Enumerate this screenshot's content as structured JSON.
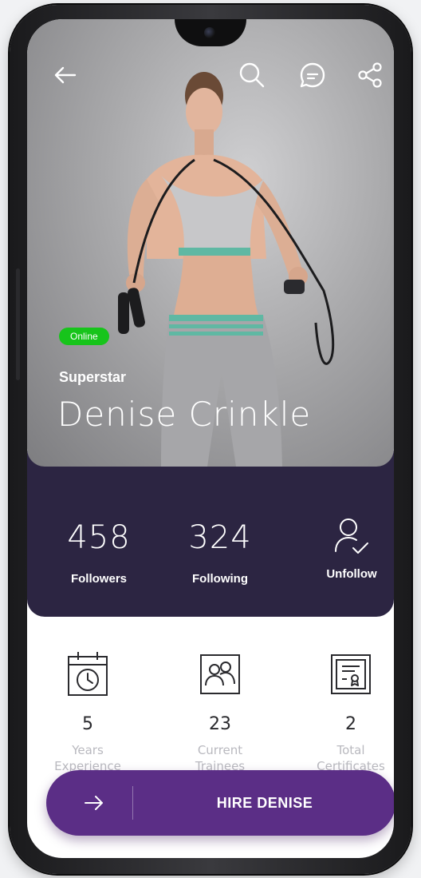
{
  "profile": {
    "status": "Online",
    "rank": "Superstar",
    "name": "Denise Crinkle"
  },
  "stats": [
    {
      "value": "458",
      "label": "Followers"
    },
    {
      "value": "324",
      "label": "Following"
    },
    {
      "label": "Unfollow",
      "icon": "user-check-icon"
    }
  ],
  "info": [
    {
      "value": "5",
      "caption_line1": "Years",
      "caption_line2": "Experience",
      "icon": "calendar-clock-icon"
    },
    {
      "value": "23",
      "caption_line1": "Current",
      "caption_line2": "Trainees",
      "icon": "users-icon"
    },
    {
      "value": "2",
      "caption_line1": "Total",
      "caption_line2": "Certificates",
      "icon": "certificate-icon"
    }
  ],
  "hire": {
    "label": "HIRE DENISE",
    "icon": "arrow-right-icon"
  },
  "topbar": {
    "icons": [
      "back-arrow-icon",
      "search-icon",
      "message-icon",
      "share-icon"
    ]
  },
  "colors": {
    "online": "#17c41b",
    "stats_panel": "#2c2542",
    "hire_button": "#5b2e86"
  }
}
